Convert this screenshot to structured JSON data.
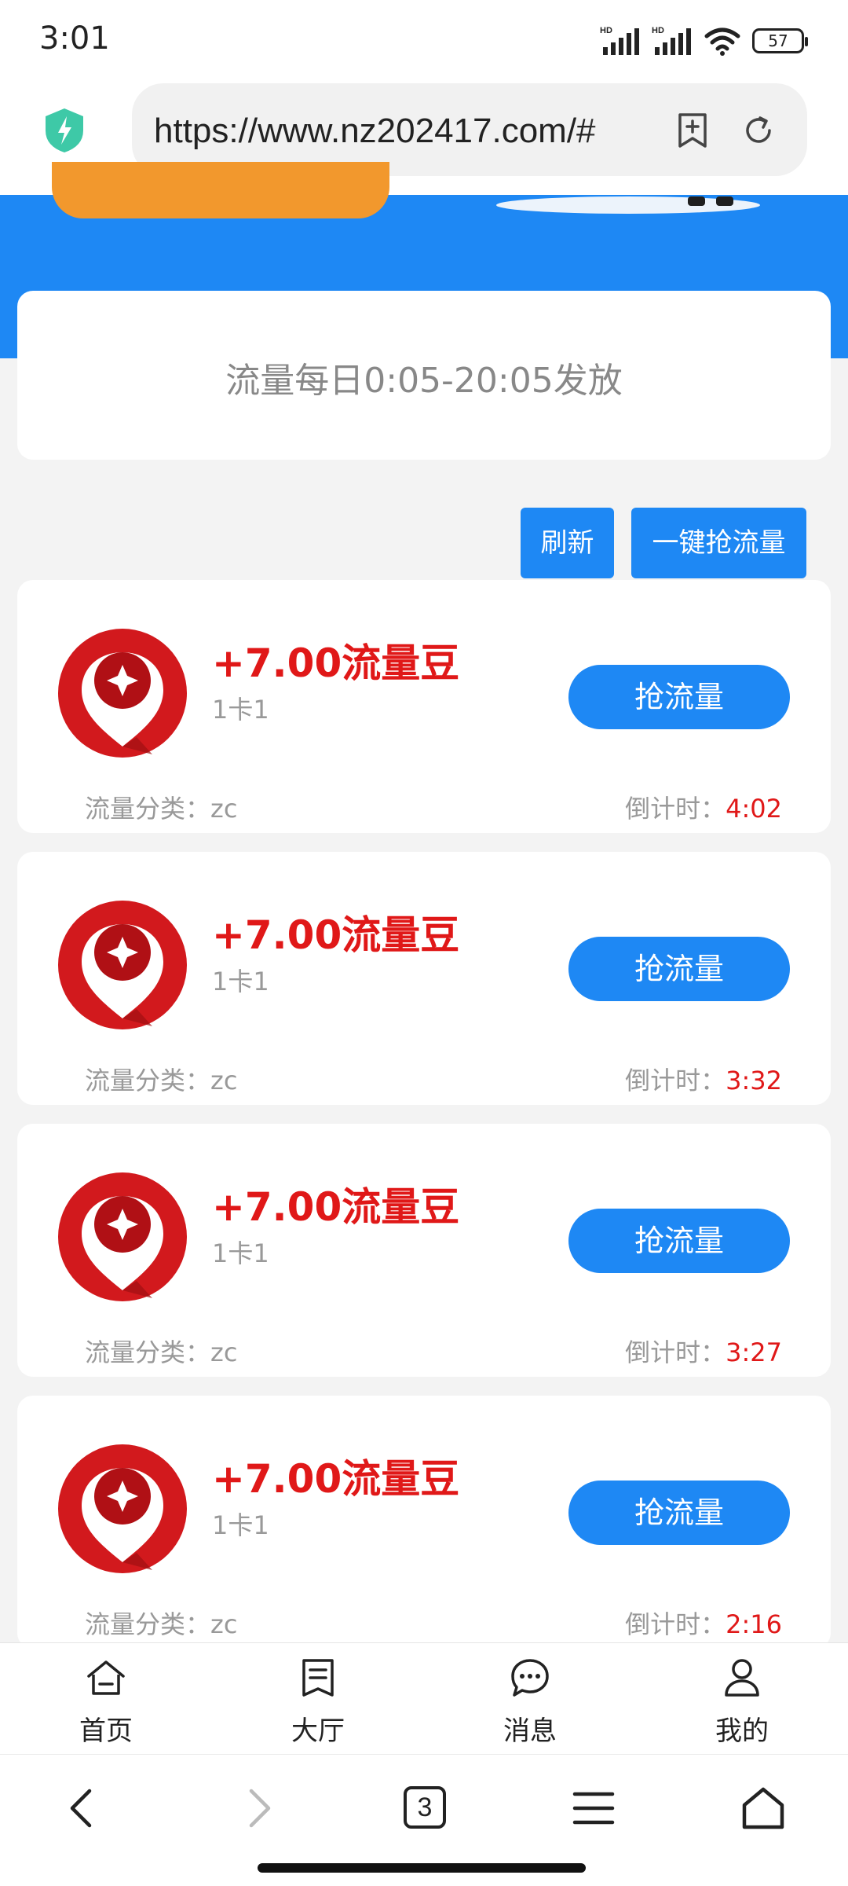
{
  "status_bar": {
    "time": "3:01",
    "network_1": "HD",
    "network_2": "HD",
    "battery": "57"
  },
  "browser": {
    "url": "https://www.nz202417.com/#",
    "tab_count": "3"
  },
  "notice": {
    "text": "流量每日0:05-20:05发放"
  },
  "actions": {
    "refresh_label": "刷新",
    "grab_all_label": "一键抢流量"
  },
  "offers": [
    {
      "amount": "+7.00流量豆",
      "sub": "1卡1",
      "button": "抢流量",
      "category_label": "流量分类：",
      "category": "zc",
      "countdown_label": "倒计时：",
      "countdown": "4:02"
    },
    {
      "amount": "+7.00流量豆",
      "sub": "1卡1",
      "button": "抢流量",
      "category_label": "流量分类：",
      "category": "zc",
      "countdown_label": "倒计时：",
      "countdown": "3:32"
    },
    {
      "amount": "+7.00流量豆",
      "sub": "1卡1",
      "button": "抢流量",
      "category_label": "流量分类：",
      "category": "zc",
      "countdown_label": "倒计时：",
      "countdown": "3:27"
    },
    {
      "amount": "+7.00流量豆",
      "sub": "1卡1",
      "button": "抢流量",
      "category_label": "流量分类：",
      "category": "zc",
      "countdown_label": "倒计时：",
      "countdown": "2:16"
    }
  ],
  "tab_bar": {
    "items": [
      {
        "label": "首页",
        "icon": "home-icon"
      },
      {
        "label": "大厅",
        "icon": "document-icon"
      },
      {
        "label": "消息",
        "icon": "chat-bubble-icon"
      },
      {
        "label": "我的",
        "icon": "user-icon"
      }
    ]
  },
  "colors": {
    "primary": "#1e88f4",
    "accent_red": "#e01818",
    "orange": "#f2982d"
  }
}
